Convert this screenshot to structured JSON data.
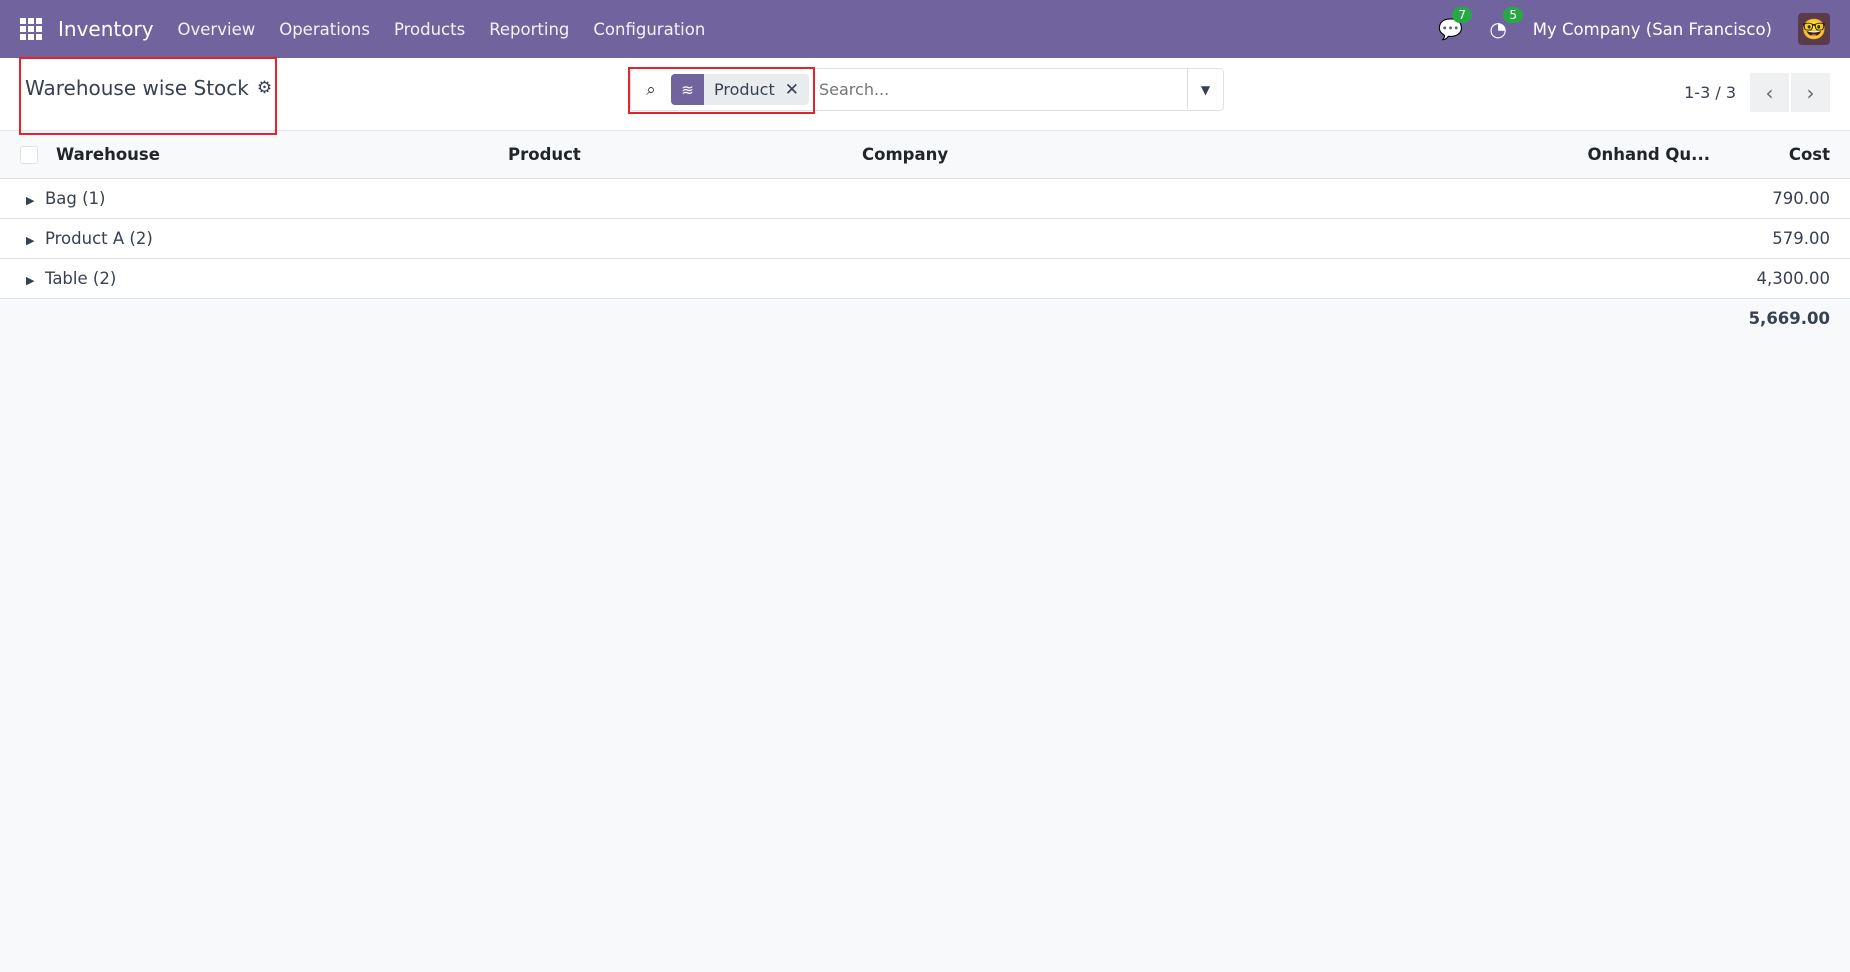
{
  "nav": {
    "app": "Inventory",
    "menu": [
      "Overview",
      "Operations",
      "Products",
      "Reporting",
      "Configuration"
    ],
    "messages_count": "7",
    "activities_count": "5",
    "company": "My Company (San Francisco)"
  },
  "control": {
    "title": "Warehouse wise Stock",
    "facet": "Product",
    "search_placeholder": "Search...",
    "pager": "1-3 / 3"
  },
  "table": {
    "headers": [
      "Warehouse",
      "Product",
      "Company",
      "Onhand Qu...",
      "Cost"
    ],
    "groups": [
      {
        "label": "Bag (1)",
        "cost": "790.00"
      },
      {
        "label": "Product A (2)",
        "cost": "579.00"
      },
      {
        "label": "Table (2)",
        "cost": "4,300.00"
      }
    ],
    "total_cost": "5,669.00"
  }
}
